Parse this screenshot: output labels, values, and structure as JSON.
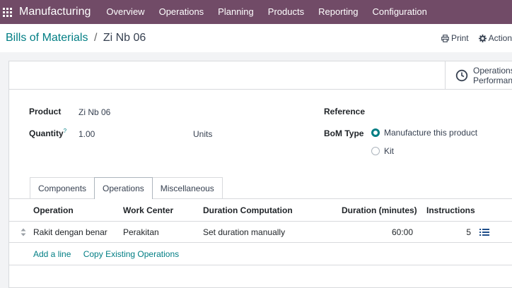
{
  "topbar": {
    "app_name": "Manufacturing",
    "menu": [
      "Overview",
      "Operations",
      "Planning",
      "Products",
      "Reporting",
      "Configuration"
    ]
  },
  "breadcrumb": {
    "parent": "Bills of Materials",
    "separator": "/",
    "current": "Zi Nb 06"
  },
  "actions": {
    "print": "Print",
    "action": "Action"
  },
  "smart_button": {
    "line1": "Operations",
    "line2": "Performance"
  },
  "form": {
    "product_label": "Product",
    "product_value": "Zi Nb 06",
    "quantity_label": "Quantity",
    "quantity_help": "?",
    "quantity_value": "1.00",
    "quantity_uom": "Units",
    "reference_label": "Reference",
    "bom_type_label": "BoM Type",
    "bom_type_options": [
      {
        "label": "Manufacture this product",
        "selected": true
      },
      {
        "label": "Kit",
        "selected": false
      }
    ]
  },
  "tabs": [
    {
      "label": "Components",
      "active": false
    },
    {
      "label": "Operations",
      "active": true
    },
    {
      "label": "Miscellaneous",
      "active": false
    }
  ],
  "table": {
    "columns": [
      "Operation",
      "Work Center",
      "Duration Computation",
      "Duration (minutes)",
      "Instructions"
    ],
    "rows": [
      {
        "operation": "Rakit dengan benar",
        "work_center": "Perakitan",
        "duration_computation": "Set duration manually",
        "duration": "60:00",
        "instructions": "5"
      }
    ]
  },
  "add_links": {
    "add_line": "Add a line",
    "copy_existing": "Copy Existing Operations"
  },
  "colors": {
    "topbar": "#714B67",
    "accent": "#017E84"
  }
}
